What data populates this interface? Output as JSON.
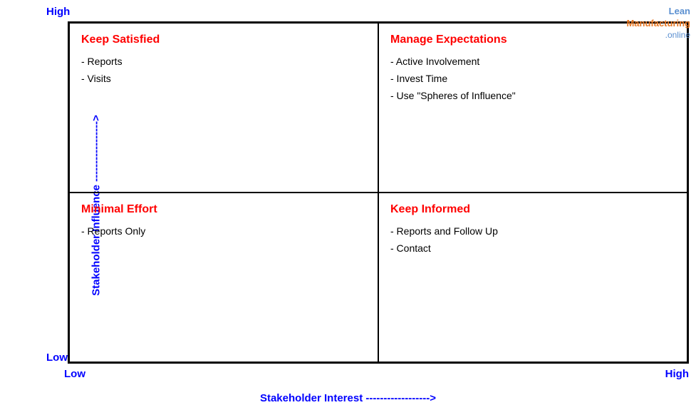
{
  "axes": {
    "y_label": "Stakeholder Influence ----------------->",
    "x_label": "Stakeholder Interest ------------------>",
    "y_high": "High",
    "y_low": "Low",
    "x_low": "Low",
    "x_high": "High"
  },
  "quadrants": {
    "top_left": {
      "title": "Keep Satisfied",
      "items": [
        "- Reports",
        "- Visits"
      ]
    },
    "top_right": {
      "title": "Manage Expectations",
      "items": [
        "- Active Involvement",
        "- Invest Time",
        "- Use \"Spheres of Influence\""
      ]
    },
    "bottom_left": {
      "title": "Minimal Effort",
      "items": [
        "- Reports Only"
      ]
    },
    "bottom_right": {
      "title": "Keep Informed",
      "items": [
        "- Reports and Follow Up",
        "- Contact"
      ]
    }
  },
  "watermark": {
    "line1": "Lean",
    "line2": "Manufacturing",
    "line3": ".online"
  }
}
